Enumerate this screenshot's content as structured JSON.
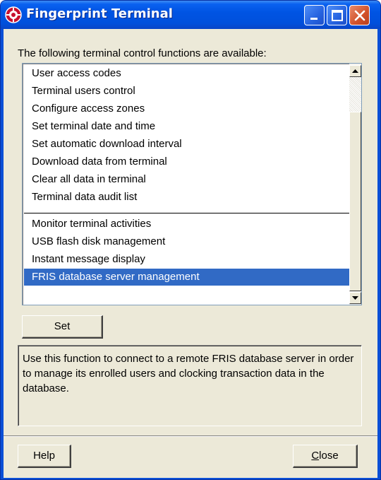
{
  "window": {
    "title": "Fingerprint Terminal",
    "controls": {
      "minimize": "minimize",
      "maximize": "maximize",
      "close": "close"
    }
  },
  "intro_text": "The following terminal control functions are available:",
  "functions": {
    "items": [
      {
        "label": "User access codes"
      },
      {
        "label": "Terminal users control"
      },
      {
        "label": "Configure access zones"
      },
      {
        "label": "Set terminal date and time"
      },
      {
        "label": "Set automatic download interval"
      },
      {
        "label": "Download data from terminal"
      },
      {
        "label": "Clear all data in terminal"
      },
      {
        "label": "Terminal data audit list"
      },
      {
        "label": "Monitor terminal activities"
      },
      {
        "label": "USB flash disk management"
      },
      {
        "label": "Instant message display"
      },
      {
        "label": "FRIS database server management"
      }
    ],
    "selected_index": 11
  },
  "buttons": {
    "set": "Set",
    "help": "Help",
    "close_first": "C",
    "close_rest": "lose"
  },
  "description": "Use this function to connect to a remote FRIS database server in order to manage its enrolled users and clocking transaction data in the database.",
  "icons": {
    "app": "gear-icon",
    "scroll_up": "arrow-up-icon",
    "scroll_down": "arrow-down-icon"
  }
}
